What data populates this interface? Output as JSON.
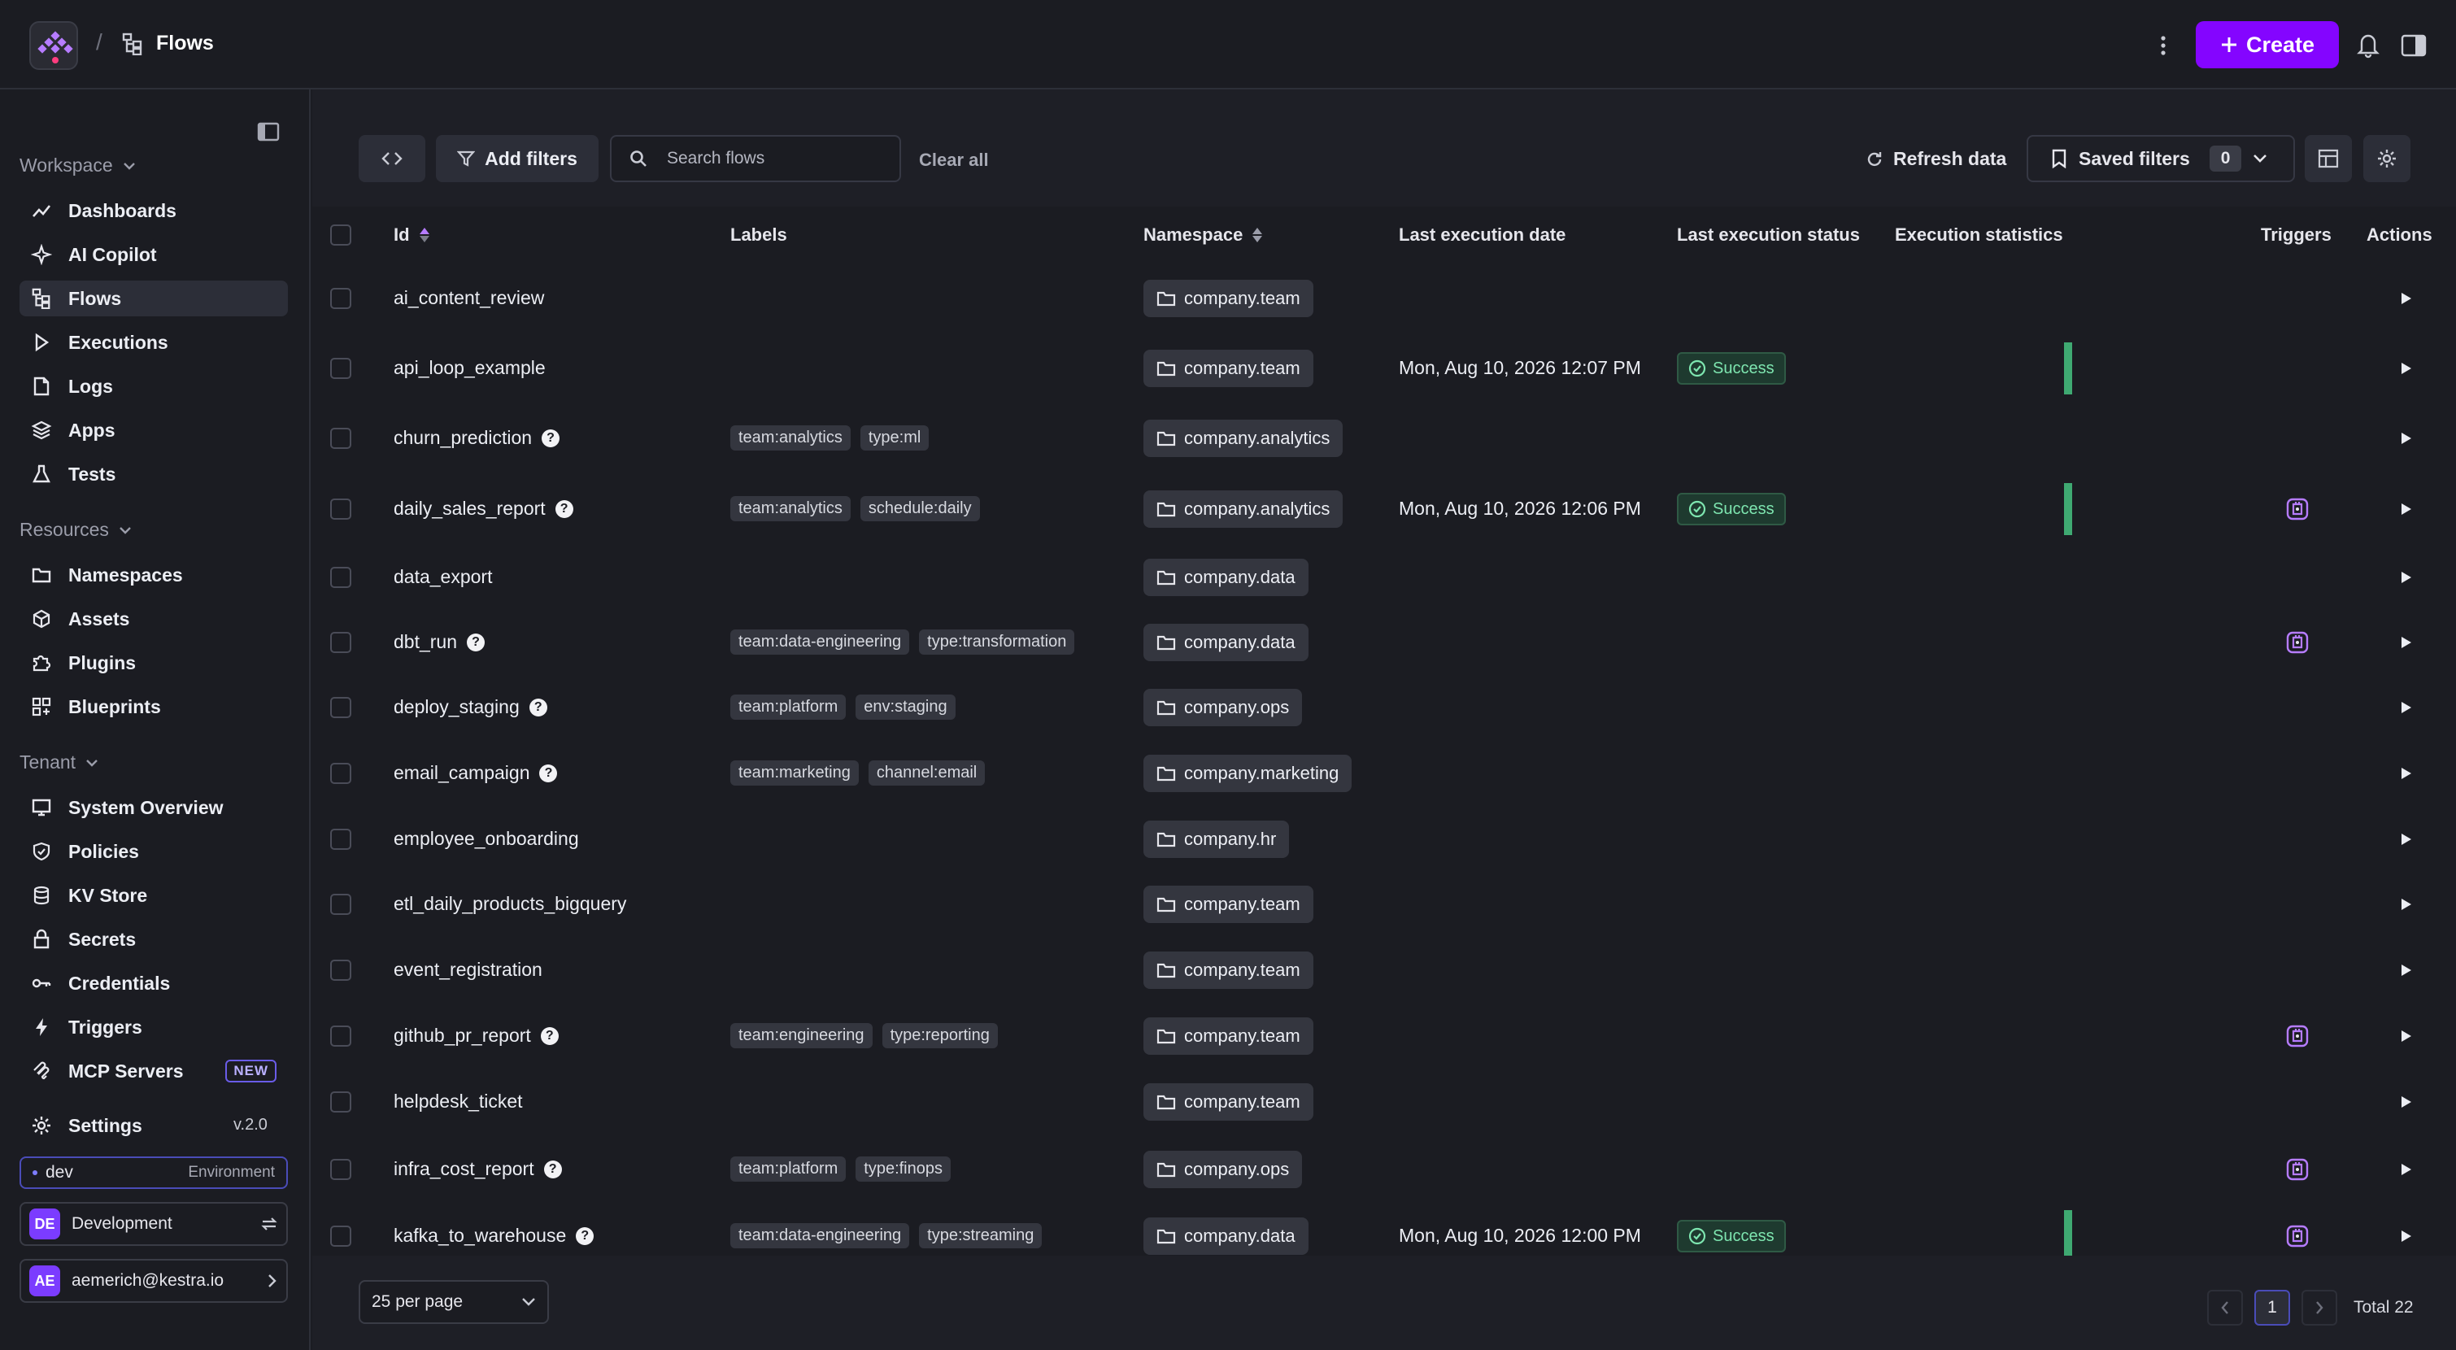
{
  "header": {
    "breadcrumb_sep": "/",
    "title": "Flows",
    "create_label": "Create"
  },
  "sidebar": {
    "workspace_label": "Workspace",
    "workspace_items": [
      {
        "label": "Dashboards",
        "icon": "chart-icon"
      },
      {
        "label": "AI Copilot",
        "icon": "sparkle-icon"
      },
      {
        "label": "Flows",
        "icon": "flows-icon",
        "active": true
      },
      {
        "label": "Executions",
        "icon": "play-icon"
      },
      {
        "label": "Logs",
        "icon": "file-icon"
      },
      {
        "label": "Apps",
        "icon": "layers-icon"
      },
      {
        "label": "Tests",
        "icon": "flask-icon"
      }
    ],
    "resources_label": "Resources",
    "resources_items": [
      {
        "label": "Namespaces",
        "icon": "folder-icon"
      },
      {
        "label": "Assets",
        "icon": "cube-icon"
      },
      {
        "label": "Plugins",
        "icon": "puzzle-icon"
      },
      {
        "label": "Blueprints",
        "icon": "blueprint-icon"
      }
    ],
    "tenant_label": "Tenant",
    "tenant_items": [
      {
        "label": "System Overview",
        "icon": "monitor-icon"
      },
      {
        "label": "Policies",
        "icon": "shield-icon"
      },
      {
        "label": "KV Store",
        "icon": "database-icon"
      },
      {
        "label": "Secrets",
        "icon": "lock-icon"
      },
      {
        "label": "Credentials",
        "icon": "key-icon"
      },
      {
        "label": "Triggers",
        "icon": "bolt-icon"
      },
      {
        "label": "MCP Servers",
        "icon": "mcp-icon",
        "badge": "NEW"
      }
    ],
    "settings_label": "Settings",
    "version": "v.2.0",
    "env_name": "dev",
    "env_label": "Environment",
    "tenant_initials": "DE",
    "tenant_name": "Development",
    "user_initials": "AE",
    "user_email": "aemerich@kestra.io"
  },
  "toolbar": {
    "add_filters": "Add filters",
    "search_placeholder": "Search flows",
    "clear_all": "Clear all",
    "refresh": "Refresh data",
    "saved_filters": "Saved filters",
    "saved_count": "0"
  },
  "table": {
    "columns": [
      "Id",
      "Labels",
      "Namespace",
      "Last execution date",
      "Last execution status",
      "Execution statistics",
      "Triggers",
      "Actions"
    ],
    "rows": [
      {
        "id": "ai_content_review",
        "help": false,
        "labels": [],
        "namespace": "company.team",
        "date": "",
        "status": "",
        "stat": 0,
        "trigger": false
      },
      {
        "id": "api_loop_example",
        "help": false,
        "labels": [],
        "namespace": "company.team",
        "date": "Mon, Aug 10, 2026 12:07 PM",
        "status": "Success",
        "stat": 1,
        "trigger": false
      },
      {
        "id": "churn_prediction",
        "help": true,
        "labels": [
          "team:analytics",
          "type:ml"
        ],
        "namespace": "company.analytics",
        "date": "",
        "status": "",
        "stat": 0,
        "trigger": false
      },
      {
        "id": "daily_sales_report",
        "help": true,
        "labels": [
          "team:analytics",
          "schedule:daily"
        ],
        "namespace": "company.analytics",
        "date": "Mon, Aug 10, 2026 12:06 PM",
        "status": "Success",
        "stat": 1,
        "trigger": true
      },
      {
        "id": "data_export",
        "help": false,
        "labels": [],
        "namespace": "company.data",
        "date": "",
        "status": "",
        "stat": 0,
        "trigger": false
      },
      {
        "id": "dbt_run",
        "help": true,
        "labels": [
          "team:data-engineering",
          "type:transformation"
        ],
        "namespace": "company.data",
        "date": "",
        "status": "",
        "stat": 0,
        "trigger": true
      },
      {
        "id": "deploy_staging",
        "help": true,
        "labels": [
          "team:platform",
          "env:staging"
        ],
        "namespace": "company.ops",
        "date": "",
        "status": "",
        "stat": 0,
        "trigger": false
      },
      {
        "id": "email_campaign",
        "help": true,
        "labels": [
          "team:marketing",
          "channel:email"
        ],
        "namespace": "company.marketing",
        "date": "",
        "status": "",
        "stat": 0,
        "trigger": false
      },
      {
        "id": "employee_onboarding",
        "help": false,
        "labels": [],
        "namespace": "company.hr",
        "date": "",
        "status": "",
        "stat": 0,
        "trigger": false
      },
      {
        "id": "etl_daily_products_bigquery",
        "help": false,
        "labels": [],
        "namespace": "company.team",
        "date": "",
        "status": "",
        "stat": 0,
        "trigger": false
      },
      {
        "id": "event_registration",
        "help": false,
        "labels": [],
        "namespace": "company.team",
        "date": "",
        "status": "",
        "stat": 0,
        "trigger": false
      },
      {
        "id": "github_pr_report",
        "help": true,
        "labels": [
          "team:engineering",
          "type:reporting"
        ],
        "namespace": "company.team",
        "date": "",
        "status": "",
        "stat": 0,
        "trigger": true
      },
      {
        "id": "helpdesk_ticket",
        "help": false,
        "labels": [],
        "namespace": "company.team",
        "date": "",
        "status": "",
        "stat": 0,
        "trigger": false
      },
      {
        "id": "infra_cost_report",
        "help": true,
        "labels": [
          "team:platform",
          "type:finops"
        ],
        "namespace": "company.ops",
        "date": "",
        "status": "",
        "stat": 0,
        "trigger": true
      },
      {
        "id": "kafka_to_warehouse",
        "help": true,
        "labels": [
          "team:data-engineering",
          "type:streaming"
        ],
        "namespace": "company.data",
        "date": "Mon, Aug 10, 2026 12:00 PM",
        "status": "Success",
        "stat": 1,
        "trigger": true
      }
    ]
  },
  "footer": {
    "per_page": "25 per page",
    "current_page": "1",
    "total": "Total 22"
  },
  "colors": {
    "accent": "#8405ff",
    "success": "#3fa972"
  }
}
